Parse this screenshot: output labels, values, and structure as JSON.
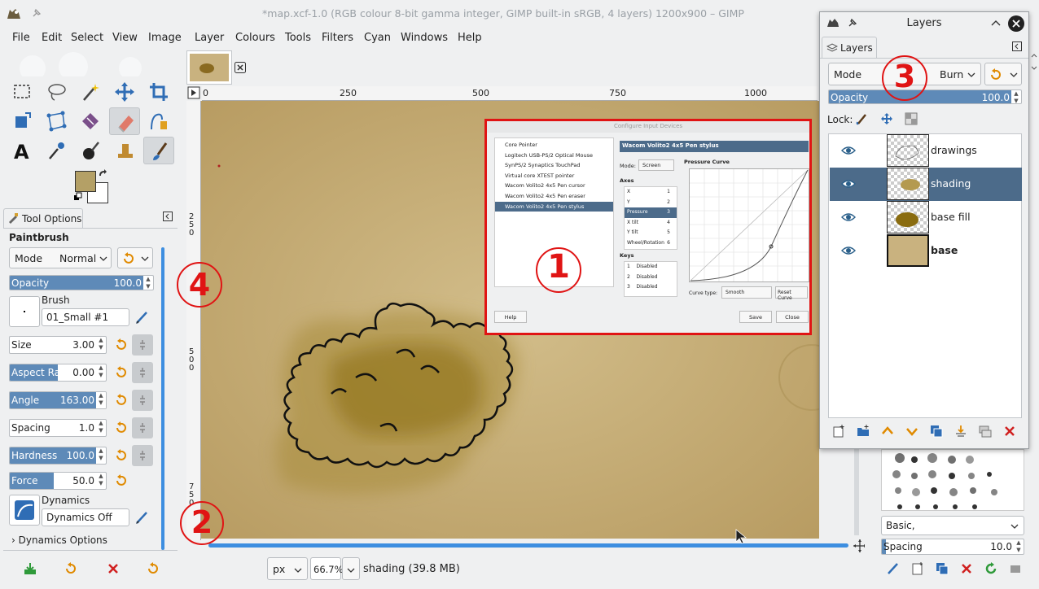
{
  "window": {
    "title": "*map.xcf-1.0 (RGB colour 8-bit gamma integer, GIMP built-in sRGB, 4 layers) 1200x900 – GIMP"
  },
  "menu": [
    "File",
    "Edit",
    "Select",
    "View",
    "Image",
    "Layer",
    "Colours",
    "Tools",
    "Filters",
    "Cyan",
    "Windows",
    "Help"
  ],
  "tool_options": {
    "tab_label": "Tool Options",
    "tool_name": "Paintbrush",
    "mode_label": "Mode",
    "mode_value": "Normal",
    "opacity_label": "Opacity",
    "opacity_value": "100.0",
    "brush_label": "Brush",
    "brush_value": "01_Small #1",
    "size_label": "Size",
    "size_value": "3.00",
    "aspect_label": "Aspect Ratio",
    "aspect_value": "0.00",
    "angle_label": "Angle",
    "angle_value": "163.00",
    "spacing_label": "Spacing",
    "spacing_value": "1.0",
    "hardness_label": "Hardness",
    "hardness_value": "100.0",
    "force_label": "Force",
    "force_value": "50.0",
    "dynamics_label": "Dynamics",
    "dynamics_value": "Dynamics Off",
    "dynamics_options_label": "Dynamics Options"
  },
  "rulers": {
    "h_ticks": [
      "0",
      "250",
      "500",
      "750",
      "1000"
    ],
    "v_ticks": [
      "2\n5\n0",
      "5\n0\n0",
      "7\n5\n0"
    ]
  },
  "statusbar": {
    "unit": "px",
    "zoom": "66.7%",
    "info": "shading (39.8 MB)"
  },
  "input_dialog": {
    "title": "Configure Input Devices",
    "devices": [
      "Core Pointer",
      "Logitech USB-PS/2 Optical Mouse",
      "SynPS/2 Synaptics TouchPad",
      "Virtual core XTEST pointer",
      "Wacom Volito2 4x5 Pen cursor",
      "Wacom Volito2 4x5 Pen eraser",
      "Wacom Volito2 4x5 Pen stylus"
    ],
    "selected_device": "Wacom Volito2 4x5 Pen stylus",
    "mode_label": "Mode:",
    "mode_value": "Screen",
    "axes_label": "Axes",
    "axes": [
      {
        "name": "X",
        "num": "1"
      },
      {
        "name": "Y",
        "num": "2"
      },
      {
        "name": "Pressure",
        "num": "3"
      },
      {
        "name": "X tilt",
        "num": "4"
      },
      {
        "name": "Y tilt",
        "num": "5"
      },
      {
        "name": "Wheel/Rotation",
        "num": "6"
      }
    ],
    "keys_label": "Keys",
    "keys": [
      {
        "num": "1",
        "val": "Disabled"
      },
      {
        "num": "2",
        "val": "Disabled"
      },
      {
        "num": "3",
        "val": "Disabled"
      }
    ],
    "curve_label": "Pressure Curve",
    "curve_type_label": "Curve type:",
    "curve_type_value": "Smooth",
    "reset_label": "Reset Curve",
    "help_label": "Help",
    "save_label": "Save",
    "close_label": "Close"
  },
  "layers": {
    "window_title": "Layers",
    "tab_label": "Layers",
    "mode_label": "Mode",
    "mode_value": "Burn",
    "opacity_label": "Opacity",
    "opacity_value": "100.0",
    "lock_label": "Lock:",
    "items": [
      {
        "name": "drawings",
        "selected": false,
        "bold": false
      },
      {
        "name": "shading",
        "selected": true,
        "bold": false
      },
      {
        "name": "base fill",
        "selected": false,
        "bold": false
      },
      {
        "name": "base",
        "selected": false,
        "bold": true
      }
    ]
  },
  "brushes": {
    "preset": "Basic,",
    "spacing_label": "Spacing",
    "spacing_value": "10.0"
  },
  "annotations": [
    "1",
    "2",
    "3",
    "4"
  ],
  "colors": {
    "accent": "#5e8ab8",
    "selection": "#4c6b8a",
    "annotation_red": "#e01414",
    "parchment": "#c9b27f",
    "foreground_color": "#b4a066"
  }
}
